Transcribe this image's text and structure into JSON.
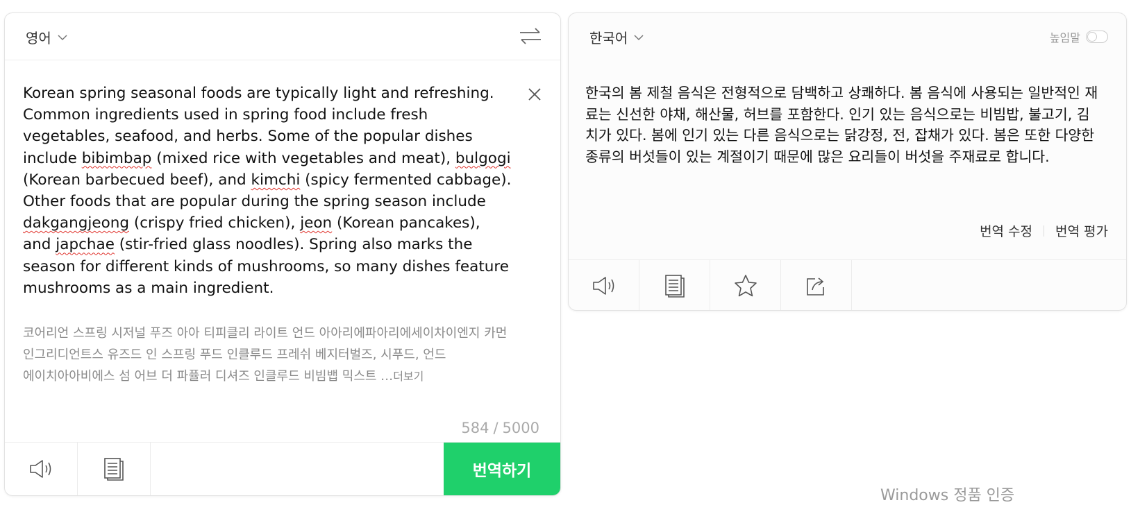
{
  "source": {
    "language": "영어",
    "text_segments": [
      {
        "t": "Korean spring seasonal foods are typically light and refreshing. Common ingredients used in spring food include fresh vegetables, seafood, and herbs. Some of the popular dishes include "
      },
      {
        "t": "bibimbap",
        "spell": true
      },
      {
        "t": " (mixed rice with vegetables and meat), "
      },
      {
        "t": "bulgogi",
        "spell": true
      },
      {
        "t": " (Korean barbecued beef), and "
      },
      {
        "t": "kimchi",
        "spell": true
      },
      {
        "t": " (spicy fermented cabbage). Other foods that are popular during the spring season include "
      },
      {
        "t": "dakgangjeong",
        "spell": true
      },
      {
        "t": " (crispy fried chicken), "
      },
      {
        "t": "jeon",
        "spell": true
      },
      {
        "t": " (Korean pancakes), and "
      },
      {
        "t": "japchae",
        "spell": true
      },
      {
        "t": " (stir-fried glass noodles). Spring also marks the season for different kinds of mushrooms, so many dishes feature mushrooms as a main ingredient."
      }
    ],
    "pronunciation": "코어리언 스프링 시저널 푸즈 아아 티피클리 라이트 언드 아아리에파아리에세이차이엔지 카먼 인그리디언트스 유즈드 인 스프링 푸드 인클루드 프레쉬 베지터벌즈, 시푸드, 언드 에이치아아비에스 섬 어브 더 파퓰러 디셔즈 인클루드 비빔뱁 믹스트 …",
    "more_label": "더보기",
    "char_count": "584",
    "char_max": "5000",
    "translate_label": "번역하기"
  },
  "target": {
    "language": "한국어",
    "honorific_label": "높임말",
    "honorific_on": false,
    "text": "한국의 봄 제철 음식은 전형적으로 담백하고 상쾌하다. 봄 음식에 사용되는 일반적인 재료는 신선한 야채, 해산물, 허브를 포함한다. 인기 있는 음식으로는 비빔밥, 불고기, 김치가 있다. 봄에 인기 있는 다른 음식으로는 닭강정, 전, 잡채가 있다. 봄은 또한 다양한 종류의 버섯들이 있는 계절이기 때문에 많은 요리들이 버섯을 주재료로 합니다.",
    "edit_label": "번역 수정",
    "rate_label": "번역 평가"
  },
  "colors": {
    "accent": "#1fd06b",
    "spellcheck": "#e0342e"
  },
  "watermark": "Windows 정품 인증"
}
